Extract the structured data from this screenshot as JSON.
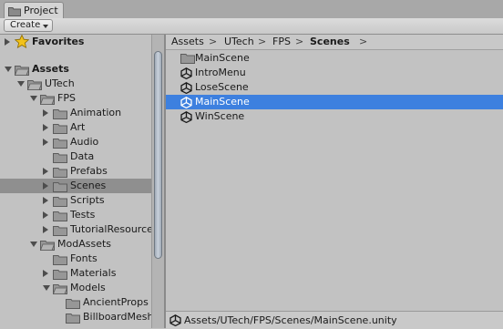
{
  "tab": {
    "label": "Project",
    "icon": "folder-icon"
  },
  "toolbar": {
    "create_label": "Create",
    "search_placeholder": ""
  },
  "tree": {
    "favorites_label": "Favorites",
    "items": [
      {
        "label": "Assets",
        "open": true,
        "bold": true,
        "selected": false
      },
      {
        "label": "UTech",
        "open": true,
        "bold": false,
        "selected": false
      },
      {
        "label": "FPS",
        "open": true,
        "bold": false,
        "selected": false
      },
      {
        "label": "Animation",
        "open": false,
        "bold": false,
        "selected": false
      },
      {
        "label": "Art",
        "open": false,
        "bold": false,
        "selected": false
      },
      {
        "label": "Audio",
        "open": false,
        "bold": false,
        "selected": false
      },
      {
        "label": "Data",
        "open": null,
        "bold": false,
        "selected": false
      },
      {
        "label": "Prefabs",
        "open": false,
        "bold": false,
        "selected": false
      },
      {
        "label": "Scenes",
        "open": false,
        "bold": false,
        "selected": true
      },
      {
        "label": "Scripts",
        "open": false,
        "bold": false,
        "selected": false
      },
      {
        "label": "Tests",
        "open": false,
        "bold": false,
        "selected": false
      },
      {
        "label": "TutorialResources",
        "open": false,
        "bold": false,
        "selected": false
      },
      {
        "label": "ModAssets",
        "open": true,
        "bold": false,
        "selected": false
      },
      {
        "label": "Fonts",
        "open": null,
        "bold": false,
        "selected": false
      },
      {
        "label": "Materials",
        "open": false,
        "bold": false,
        "selected": false
      },
      {
        "label": "Models",
        "open": true,
        "bold": false,
        "selected": false
      },
      {
        "label": "AncientProps",
        "open": null,
        "bold": false,
        "selected": false
      },
      {
        "label": "BillboardMesh",
        "open": null,
        "bold": false,
        "selected": false
      }
    ]
  },
  "breadcrumb": {
    "items": [
      "Assets",
      "UTech",
      "FPS",
      "Scenes"
    ],
    "separator": ">"
  },
  "files": [
    {
      "name": "MainScene",
      "kind": "folder",
      "selected": false
    },
    {
      "name": "IntroMenu",
      "kind": "scene",
      "selected": false
    },
    {
      "name": "LoseScene",
      "kind": "scene",
      "selected": false
    },
    {
      "name": "MainScene",
      "kind": "scene",
      "selected": true
    },
    {
      "name": "WinScene",
      "kind": "scene",
      "selected": false
    }
  ],
  "status": {
    "path": "Assets/UTech/FPS/Scenes/MainScene.unity",
    "icon": "unity-scene-icon"
  },
  "colors": {
    "selection_blue": "#3d80df",
    "tree_selection": "#8f8f8f",
    "panel": "#c2c2c2",
    "folder": "#9a9a9a"
  }
}
